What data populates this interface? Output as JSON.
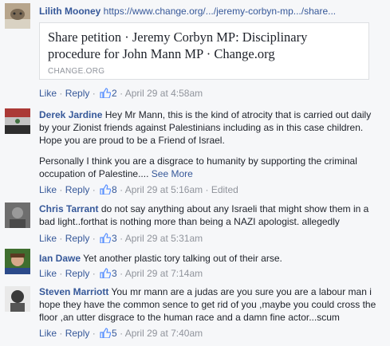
{
  "colors": {
    "link": "#365899",
    "muted": "#90949c",
    "background": "#f6f7f9"
  },
  "comments": [
    {
      "author": "Lilith Mooney",
      "text": "https://www.change.org/.../jeremy-corbyn-mp.../share...",
      "preview": {
        "title": "Share petition · Jeremy Corbyn MP: Disciplinary procedure for John Mann MP · Change.org",
        "domain": "CHANGE.ORG"
      },
      "actions": {
        "like": "Like",
        "reply": "Reply",
        "likes": "2",
        "time": "April 29 at 4:58am"
      }
    },
    {
      "author": "Derek Jardine",
      "text": "Hey Mr Mann, this is the kind of atrocity that is carried out daily by your Zionist friends against Palestinians including as in this case children. Hope you are proud to be a Friend of Israel.",
      "text2": "Personally I think you are a disgrace to humanity by supporting the criminal occupation of Palestine....",
      "see_more": "See More",
      "actions": {
        "like": "Like",
        "reply": "Reply",
        "likes": "8",
        "time": "April 29 at 5:16am",
        "edited": "Edited"
      }
    },
    {
      "author": "Chris Tarrant",
      "text": "do not say anything about any Israeli that might show them in a bad light..forthat is nothing more than being a NAZI apologist. allegedly",
      "actions": {
        "like": "Like",
        "reply": "Reply",
        "likes": "3",
        "time": "April 29 at 5:31am"
      }
    },
    {
      "author": "Ian Dawe",
      "text": "Yet another plastic tory talking out of their arse.",
      "actions": {
        "like": "Like",
        "reply": "Reply",
        "likes": "3",
        "time": "April 29 at 7:14am"
      }
    },
    {
      "author": "Steven Marriott",
      "text": "You mr mann are a judas are you sure you are a labour man i hope they have the common sence to get rid of you ,maybe you could cross the floor ,an utter disgrace to the human race and a damn fine actor...scum",
      "actions": {
        "like": "Like",
        "reply": "Reply",
        "likes": "5",
        "time": "April 29 at 7:40am"
      }
    }
  ],
  "separators": {
    "dot": " · "
  }
}
